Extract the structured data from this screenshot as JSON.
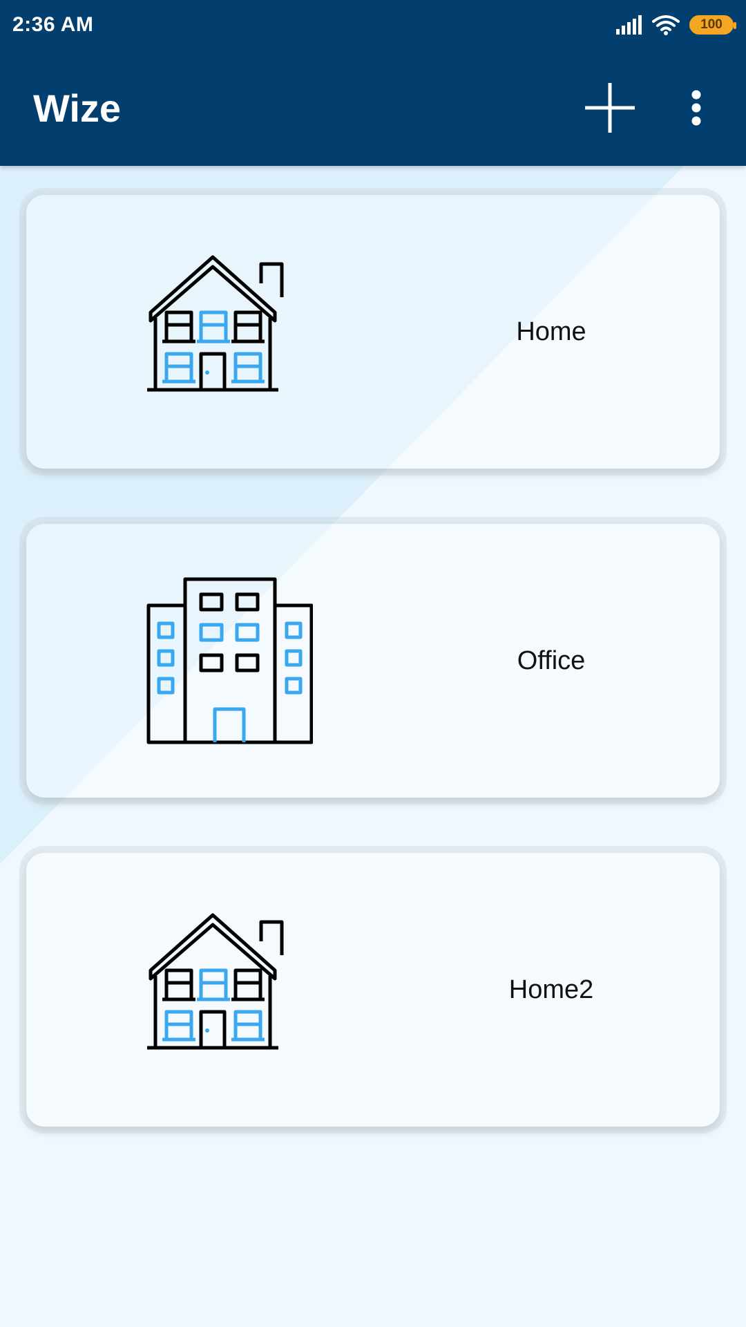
{
  "status_bar": {
    "time": "2:36 AM",
    "battery": "100",
    "signal_icon": "signal-bars-icon",
    "wifi_icon": "wifi-icon"
  },
  "app_bar": {
    "title": "Wize",
    "add_icon": "plus-icon",
    "more_icon": "more-vertical-icon"
  },
  "locations": [
    {
      "label": "Home",
      "icon": "house-icon"
    },
    {
      "label": "Office",
      "icon": "office-building-icon"
    },
    {
      "label": "Home2",
      "icon": "house-icon"
    }
  ],
  "colors": {
    "primary": "#023f6f",
    "accent_blue": "#3aa8ee",
    "background": "#eef8fe",
    "battery": "#f5a623"
  }
}
